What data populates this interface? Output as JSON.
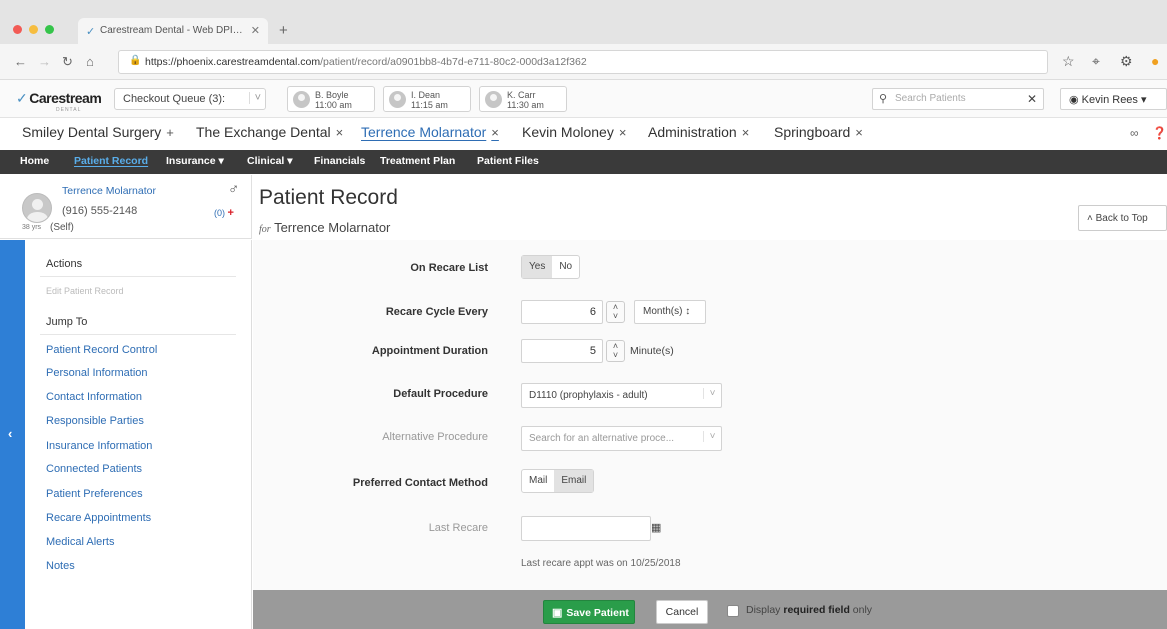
{
  "browser": {
    "tab_title": "Carestream Dental - Web DPI…",
    "new_tab": "+",
    "url_host": "https://phoenix.carestreamdental.com",
    "url_path": "/patient/record/a0901bb8-4b7d-e711-80c2-000d3a12f362",
    "traffic_colors": [
      "#f25b55",
      "#f6bd3f",
      "#35c44a"
    ]
  },
  "app": {
    "logo": "Carestream",
    "logo_sub": "DENTAL",
    "checkout_queue": "Checkout Queue (3):",
    "appointments": [
      {
        "name": "B. Boyle",
        "time": "11:00 am"
      },
      {
        "name": "I. Dean",
        "time": "11:15 am"
      },
      {
        "name": "K. Carr",
        "time": "11:30 am"
      }
    ],
    "search_placeholder": "Search Patients",
    "user": "Kevin Rees"
  },
  "workspace_tabs": [
    {
      "label": "Smiley Dental Surgery",
      "mark": "+"
    },
    {
      "label": "The Exchange Dental",
      "mark": "×"
    },
    {
      "label": "Terrence Molarnator",
      "mark": "×"
    },
    {
      "label": "Kevin Moloney",
      "mark": "×"
    },
    {
      "label": "Administration",
      "mark": "×"
    },
    {
      "label": "Springboard",
      "mark": "×"
    }
  ],
  "main_nav": [
    "Home",
    "Patient Record",
    "Insurance ▾",
    "Clinical ▾",
    "Financials",
    "Treatment Plan",
    "Patient Files"
  ],
  "patient": {
    "name": "Terrence Molarnator",
    "phone": "(916) 555-2148",
    "age": "38 yrs",
    "relation": "(Self)",
    "alerts": "(0)",
    "gender_symbol": "♂"
  },
  "page": {
    "title": "Patient Record",
    "for_prefix": "for",
    "for_name": "Terrence Molarnator",
    "back_to_top": "Back to Top"
  },
  "sidebar": {
    "actions_heading": "Actions",
    "edit_link": "Edit Patient Record",
    "jump_heading": "Jump To",
    "links": [
      "Patient Record Control",
      "Personal Information",
      "Contact Information",
      "Responsible Parties",
      "Insurance Information",
      "Connected Patients",
      "Patient Preferences",
      "Recare Appointments",
      "Medical Alerts",
      "Notes"
    ]
  },
  "form": {
    "on_recare_label": "On Recare List",
    "on_recare_yes": "Yes",
    "on_recare_no": "No",
    "recare_cycle_label": "Recare Cycle Every",
    "recare_cycle_value": "6",
    "recare_cycle_unit": "Month(s) ↕",
    "appt_duration_label": "Appointment Duration",
    "appt_duration_value": "5",
    "appt_duration_unit": "Minute(s)",
    "default_proc_label": "Default Procedure",
    "default_proc_value": "D1110 (prophylaxis - adult)",
    "alt_proc_label": "Alternative Procedure",
    "alt_proc_placeholder": "Search for an alternative proce...",
    "contact_label": "Preferred Contact Method",
    "contact_mail": "Mail",
    "contact_email": "Email",
    "last_recare_label": "Last Recare",
    "last_recare_note": "Last recare appt was on 10/25/2018"
  },
  "actions": {
    "save": "Save Patient",
    "cancel": "Cancel",
    "display_prefix": "Display",
    "display_bold": "required field",
    "display_suffix": "only"
  }
}
